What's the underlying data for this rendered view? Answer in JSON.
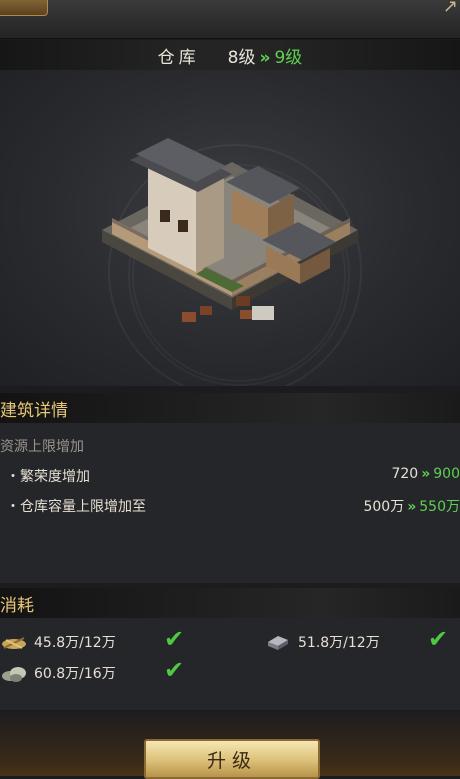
{
  "building": {
    "name": "仓库",
    "level_current": "8级",
    "level_next": "9级",
    "arrow": "»"
  },
  "details": {
    "heading": "建筑详情",
    "subheading": "资源上限增加",
    "rows": [
      {
        "label": "・繁荣度增加",
        "from": "720",
        "to": "900"
      },
      {
        "label": "・仓库容量上限增加至",
        "from": "500万",
        "to": "550万"
      }
    ]
  },
  "cost": {
    "heading": "消耗",
    "items": [
      {
        "icon": "grain-icon",
        "value": "45.8万/12万",
        "satisfied": true
      },
      {
        "icon": "iron-icon",
        "value": "51.8万/12万",
        "satisfied": true
      },
      {
        "icon": "stone-icon",
        "value": "60.8万/16万",
        "satisfied": true
      }
    ],
    "check_glyph": "✔"
  },
  "actions": {
    "upgrade_label": "升级"
  },
  "colors": {
    "accent_green": "#5fd052",
    "heading_gold": "#e8c877"
  }
}
